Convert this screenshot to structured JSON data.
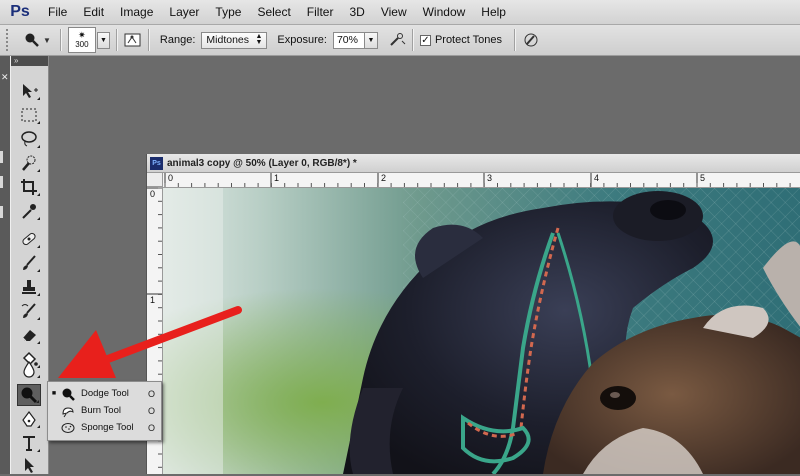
{
  "app": {
    "logo": "Ps"
  },
  "menu": [
    "File",
    "Edit",
    "Image",
    "Layer",
    "Type",
    "Select",
    "Filter",
    "3D",
    "View",
    "Window",
    "Help"
  ],
  "options": {
    "tool_icon": "dodge-tool-icon",
    "brush_size": "300",
    "range_label": "Range:",
    "range_value": "Midtones",
    "exposure_label": "Exposure:",
    "exposure_value": "70%",
    "protect_tones_label": "Protect Tones",
    "protect_tones_checked": true
  },
  "document": {
    "title": "animal3 copy @ 50% (Layer 0, RGB/8*) *",
    "ruler_h_labels": [
      "0",
      "1",
      "2",
      "3",
      "4",
      "5"
    ],
    "ruler_v_labels": [
      "0",
      "1"
    ]
  },
  "flyout": {
    "items": [
      {
        "label": "Dodge Tool",
        "key": "O",
        "selected": true
      },
      {
        "label": "Burn Tool",
        "key": "O",
        "selected": false
      },
      {
        "label": "Sponge Tool",
        "key": "O",
        "selected": false
      }
    ]
  },
  "colors": {
    "annotation_arrow": "#e8201c",
    "menubar": "#dadada",
    "workspace": "#6b6b6b"
  }
}
